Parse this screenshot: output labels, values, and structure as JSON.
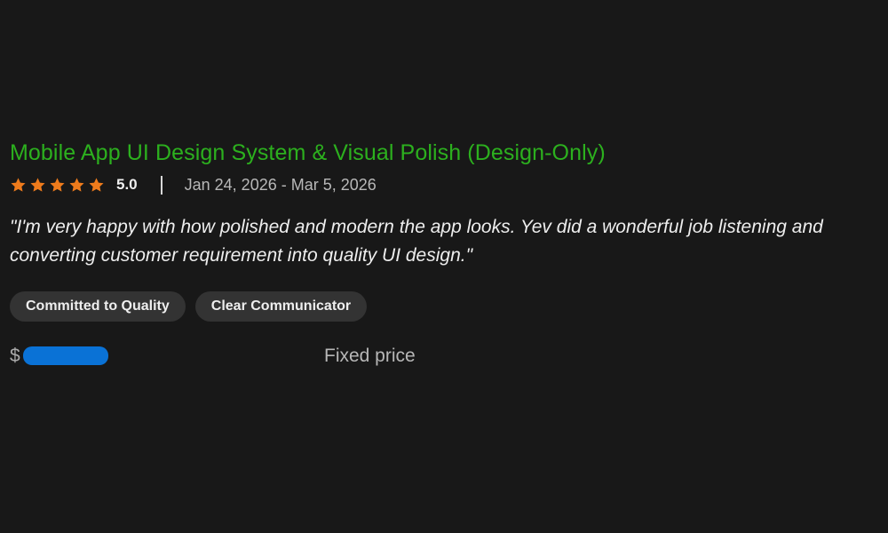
{
  "job": {
    "title": "Mobile App UI Design System & Visual Polish (Design-Only)",
    "rating": {
      "stars_filled": 5,
      "stars_total": 5,
      "value": "5.0",
      "star_icon": "star-icon"
    },
    "date_range": "Jan 24, 2026 - Mar 5, 2026",
    "review": {
      "line_1": "\"I'm very happy with how polished and modern the app looks. Yev did a wonderful job listening and",
      "line_2": "converting customer requirement into quality UI design.\""
    },
    "tags": [
      "Committed to Quality",
      "Clear Communicator"
    ],
    "price": {
      "currency_symbol": "$",
      "type": "Fixed price"
    }
  },
  "colors": {
    "background": "#181818",
    "title_green": "#2cb01e",
    "star_orange": "#ee7b1c",
    "tag_background": "#333333",
    "redaction_blue": "#0a72d6"
  }
}
